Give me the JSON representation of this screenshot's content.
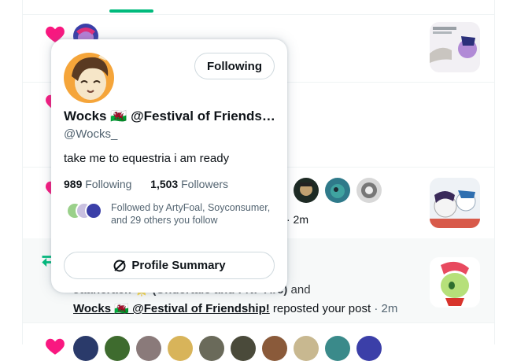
{
  "hover_card": {
    "follow_button": "Following",
    "display_name": "Wocks 🏴󠁧󠁢󠁷󠁬󠁳󠁿 @Festival of Friends…",
    "handle": "@Wocks_",
    "bio": "take me to equestria i am ready",
    "following_count": "989",
    "following_label": "Following",
    "followers_count": "1,503",
    "followers_label": "Followers",
    "followed_by": "Followed by ArtyFoal, Soyconsumer, and 29 others you follow",
    "summary_button": "Profile Summary"
  },
  "notifications": [
    {
      "type": "like"
    },
    {
      "type": "like"
    },
    {
      "type": "like",
      "time": "· 2m"
    },
    {
      "type": "repost",
      "partial_line": "Jaanerack 🌟 (Undertale and FNF Arc)",
      "and_text": "and",
      "name2": "Wocks 🏴󠁧󠁢󠁷󠁬󠁳󠁿 @Festival of Friendship!",
      "action": "reposted your post",
      "time": "· 2m"
    },
    {
      "type": "like"
    }
  ],
  "colors": {
    "heart": "#f91880",
    "repost": "#00ba7c",
    "accent_tab": "#00ba7c",
    "secondary_text": "#536471"
  },
  "icons": {
    "like": "heart-icon",
    "repost": "repost-icon",
    "summary": "summary-icon"
  }
}
